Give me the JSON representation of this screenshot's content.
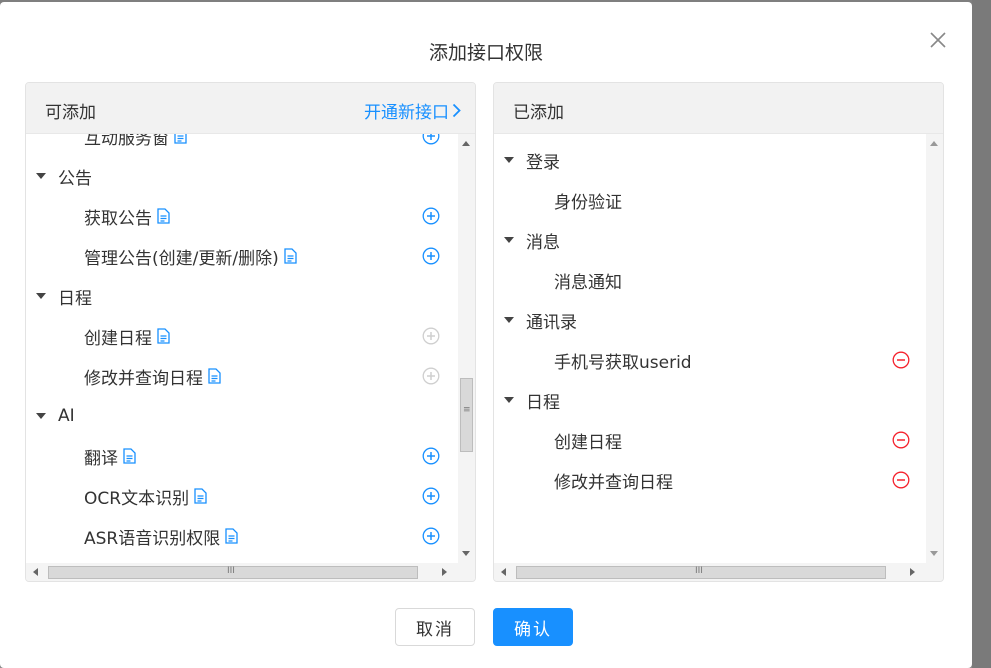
{
  "dialog": {
    "title": "添加接口权限",
    "cancel_label": "取消",
    "ok_label": "确认"
  },
  "available": {
    "header": "可添加",
    "open_link": "开通新接口",
    "rows": [
      {
        "level": "leaf",
        "label": "互动服务窗",
        "doc": true,
        "action": "add"
      },
      {
        "level": "group",
        "label": "公告"
      },
      {
        "level": "leaf",
        "label": "获取公告",
        "doc": true,
        "action": "add"
      },
      {
        "level": "leaf",
        "label": "管理公告(创建/更新/删除)",
        "doc": true,
        "action": "add"
      },
      {
        "level": "group",
        "label": "日程"
      },
      {
        "level": "leaf",
        "label": "创建日程",
        "doc": true,
        "action": "add-disabled"
      },
      {
        "level": "leaf",
        "label": "修改并查询日程",
        "doc": true,
        "action": "add-disabled"
      },
      {
        "level": "group",
        "label": "AI"
      },
      {
        "level": "leaf",
        "label": "翻译",
        "doc": true,
        "action": "add"
      },
      {
        "level": "leaf",
        "label": "OCR文本识别",
        "doc": true,
        "action": "add"
      },
      {
        "level": "leaf",
        "label": "ASR语音识别权限",
        "doc": true,
        "action": "add"
      }
    ]
  },
  "added": {
    "header": "已添加",
    "rows": [
      {
        "level": "group",
        "label": "登录"
      },
      {
        "level": "leaf",
        "label": "身份验证",
        "action": "none"
      },
      {
        "level": "group",
        "label": "消息"
      },
      {
        "level": "leaf",
        "label": "消息通知",
        "action": "none"
      },
      {
        "level": "group",
        "label": "通讯录"
      },
      {
        "level": "leaf",
        "label": "手机号获取userid",
        "action": "remove"
      },
      {
        "level": "group",
        "label": "日程"
      },
      {
        "level": "leaf",
        "label": "创建日程",
        "action": "remove"
      },
      {
        "level": "leaf",
        "label": "修改并查询日程",
        "action": "remove"
      }
    ]
  },
  "colors": {
    "accent": "#1890ff",
    "remove": "#f5222d",
    "disabled": "#cfcfcf"
  }
}
